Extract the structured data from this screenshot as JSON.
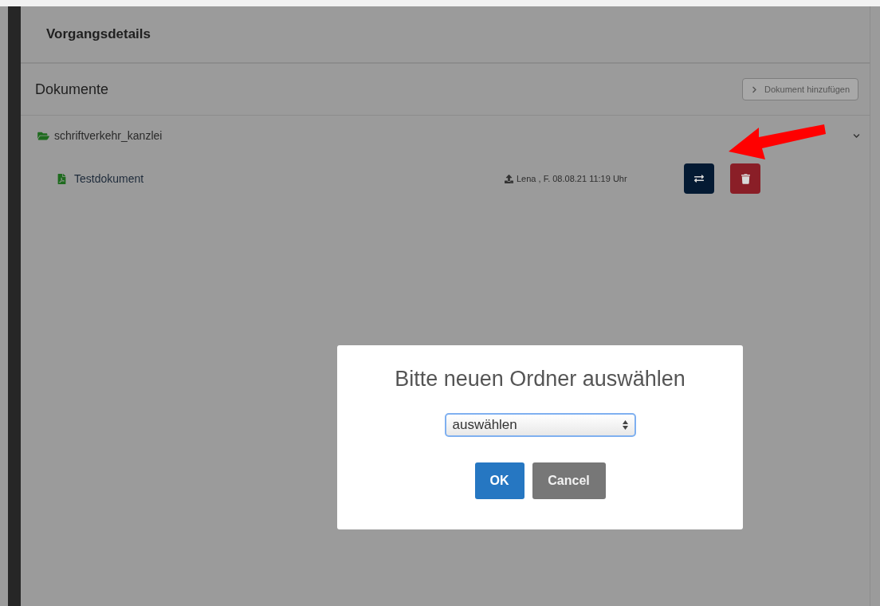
{
  "header": {
    "title": "Vorgangsdetails"
  },
  "documents": {
    "title": "Dokumente",
    "add_button": {
      "label": "Dokument hinzufügen",
      "disabled": true
    },
    "folders": [
      {
        "name": "schriftverkehr_kanzlei",
        "expanded": true,
        "children": [
          {
            "name": "Testdokument",
            "uploader": "Lena , F. 08.08.21 11:19 Uhr"
          }
        ]
      }
    ]
  },
  "dialog": {
    "title": "Bitte neuen Ordner auswählen",
    "select": {
      "value": "auswählen"
    },
    "buttons": [
      {
        "label": "OK",
        "kind": "primary"
      },
      {
        "label": "Cancel",
        "kind": "secondary"
      }
    ]
  }
}
